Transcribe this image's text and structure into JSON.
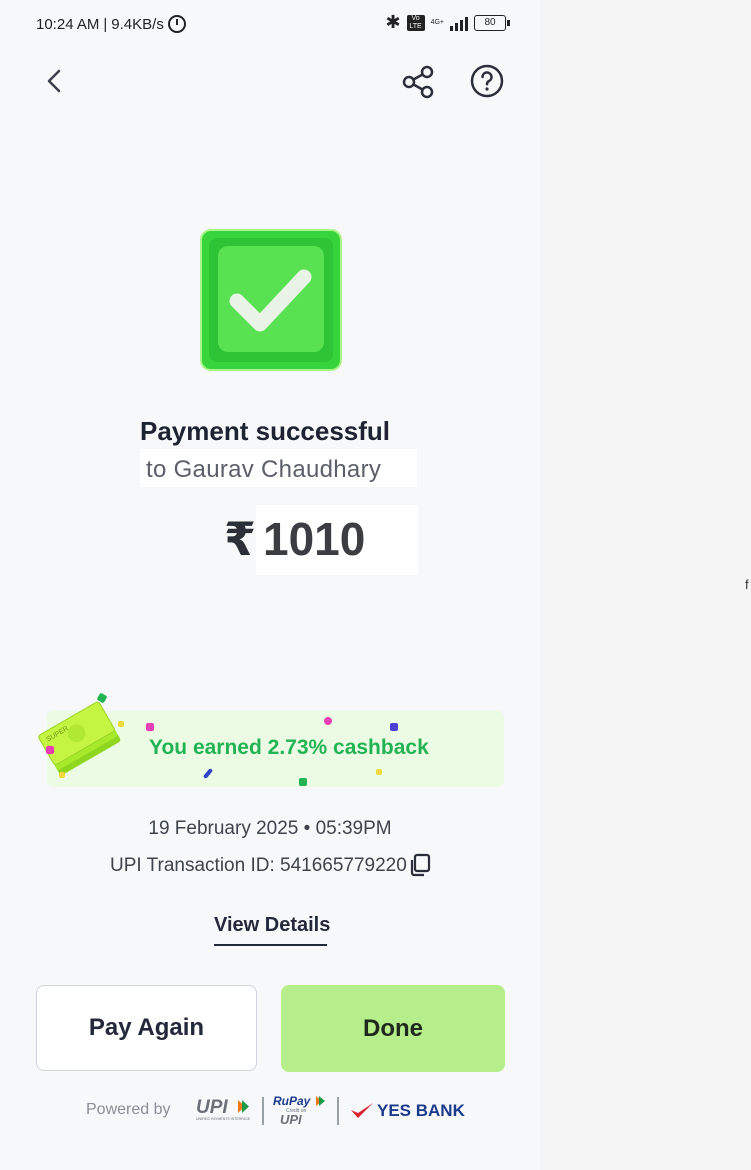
{
  "status_bar": {
    "time": "10:24 AM",
    "network_speed": "9.4KB/s",
    "network_type": "4G+",
    "volte": "Vo LTE",
    "battery": "80"
  },
  "header": {
    "back_icon": "chevron-left-icon",
    "share_icon": "share-icon",
    "help_icon": "help-circle-icon"
  },
  "result": {
    "title": "Payment successful",
    "recipient": "to Gaurav Chaudhary",
    "currency_symbol": "₹",
    "amount": "1010"
  },
  "cashback": {
    "text": "You earned 2.73% cashback",
    "badge": "SUPER"
  },
  "transaction": {
    "datetime": "19 February 2025 • 05:39PM",
    "upi_id_label": "UPI Transaction ID: 541665779220"
  },
  "links": {
    "view_details": "View Details"
  },
  "buttons": {
    "pay_again": "Pay Again",
    "done": "Done"
  },
  "footer": {
    "powered_by": "Powered by",
    "upi": "UPI",
    "upi_sub": "UNIFIED PAYMENTS INTERFACE",
    "rupay": "RuPay",
    "rupay_upi": "UPI",
    "rupay_credit": "Credit on",
    "bank": "YES BANK"
  },
  "side_panel": {
    "stray_text": "f"
  },
  "colors": {
    "success_green": "#22b354",
    "done_button": "#b5ee8b",
    "cashback_bg": "#ecfbe3",
    "bank_blue": "#1b3a8c",
    "bank_red": "#d9232d"
  }
}
